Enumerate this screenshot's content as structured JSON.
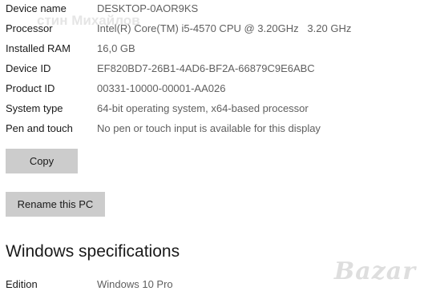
{
  "device_specs": [
    {
      "label": "Device name",
      "value": "DESKTOP-0AOR9KS"
    },
    {
      "label": "Processor",
      "value": "Intel(R) Core(TM) i5-4570 CPU @ 3.20GHz   3.20 GHz"
    },
    {
      "label": "Installed RAM",
      "value": "16,0 GB"
    },
    {
      "label": "Device ID",
      "value": "EF820BD7-26B1-4AD6-BF2A-66879C9E6ABC"
    },
    {
      "label": "Product ID",
      "value": "00331-10000-00001-AA026"
    },
    {
      "label": "System type",
      "value": "64-bit operating system, x64-based processor"
    },
    {
      "label": "Pen and touch",
      "value": "No pen or touch input is available for this display"
    }
  ],
  "buttons": {
    "copy": "Copy",
    "rename": "Rename this PC"
  },
  "windows_specs": {
    "title": "Windows specifications",
    "rows": [
      {
        "label": "Edition",
        "value": "Windows 10 Pro"
      }
    ]
  },
  "overlay": {
    "watermark": "Bazar",
    "faint_text": "стин Михайлов"
  }
}
